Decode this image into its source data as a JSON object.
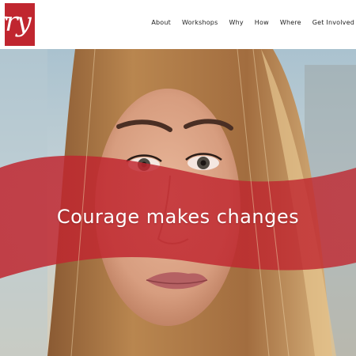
{
  "brand": {
    "logo_text": "rry",
    "logo_color": "#c0262f"
  },
  "nav": {
    "items": [
      {
        "label": "About"
      },
      {
        "label": "Workshops"
      },
      {
        "label": "Why"
      },
      {
        "label": "How"
      },
      {
        "label": "Where"
      },
      {
        "label": "Get Involved"
      }
    ]
  },
  "hero": {
    "headline": "Courage makes changes",
    "band_color": "#c0262f"
  }
}
